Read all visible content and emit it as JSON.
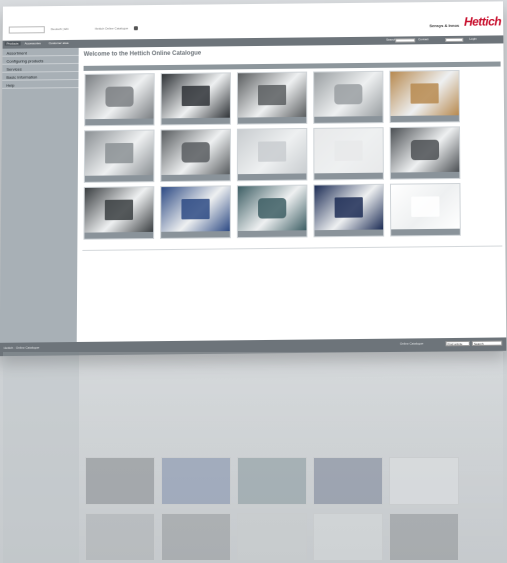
{
  "header": {
    "language": "Deutsch | EN",
    "tagline": "Hettich Online Catalogue",
    "slogan": "Sensys & Innos",
    "logo": "Hettich"
  },
  "nav": {
    "items": [
      "Products",
      "Accessories",
      "Customer area"
    ],
    "right_items": [
      "Search",
      "Contact",
      "Login"
    ]
  },
  "sidebar": {
    "items": [
      {
        "label": "Assortment"
      },
      {
        "label": "Configuring products"
      },
      {
        "label": "Services"
      },
      {
        "label": "Basic Information"
      },
      {
        "label": "Help"
      }
    ]
  },
  "main": {
    "welcome": "Welcome to the Hettich Online Catalogue",
    "section_label": "",
    "tiles": [
      {
        "name": "concealed-hinge-image",
        "color": "#7b7f83"
      },
      {
        "name": "lift-system-image",
        "color": "#2f3337"
      },
      {
        "name": "sliding-door-image",
        "color": "#5b5e60"
      },
      {
        "name": "drawer-system-image",
        "color": "#9a9fa2"
      },
      {
        "name": "drawer-box-image",
        "color": "#b7894f"
      },
      {
        "name": "office-furniture-image",
        "color": "#8b9094"
      },
      {
        "name": "desk-image",
        "color": "#585c5f"
      },
      {
        "name": "handle-image",
        "color": "#c9cdd0"
      },
      {
        "name": "cabinet-image",
        "color": "#e8e9ea"
      },
      {
        "name": "product-overview-image",
        "color": "#4c5054"
      },
      {
        "name": "fitting-kit-image",
        "color": "#3a3e41"
      },
      {
        "name": "cad-model-image",
        "color": "#2d4a84"
      },
      {
        "name": "handle-bar-image",
        "color": "#3d5e64"
      },
      {
        "name": "configurator-image",
        "color": "#1c2c55"
      },
      {
        "name": "document-image",
        "color": "#ffffff"
      }
    ]
  },
  "footer": {
    "left_text": "Hettich · Online Catalogue",
    "right_text": "Online Catalogue",
    "field_1": "Find article",
    "field_2": "Search"
  }
}
